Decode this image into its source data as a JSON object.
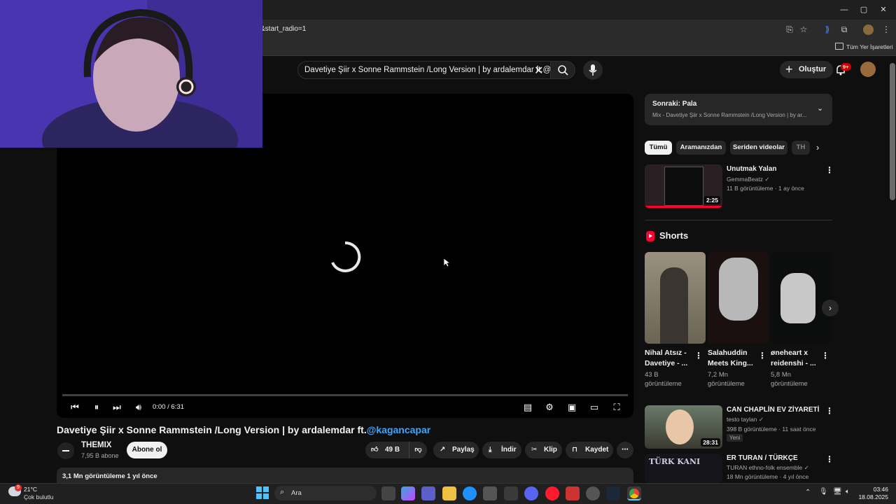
{
  "browser": {
    "address": "&start_radio=1",
    "bookmarks_label": "Tüm Yer İşaretleri",
    "window_minimize": "—",
    "window_restore": "▢",
    "window_close": "✕",
    "notifications_badge": "9+"
  },
  "header": {
    "search_value": "Davetiye Şiir x Sonne Rammstein /Long Version | by ardalemdar ft.@k",
    "create_label": "Oluştur",
    "notif_badge": "9+"
  },
  "player": {
    "time": "0:00 / 6:31",
    "progress": 0.0
  },
  "video": {
    "title_prefix": "Davetiye Şiir x Sonne Rammstein /Long Version | by ardalemdar ft.",
    "title_tag": "@kagancapar",
    "channel_name": "THEMIX",
    "channel_subs": "7,95 B abone",
    "subscribe_label": "Abone ol",
    "likes": "49 B",
    "share_label": "Paylaş",
    "download_label": "İndir",
    "clip_label": "Klip",
    "save_label": "Kaydet",
    "views_age": "3,1 Mn görüntüleme  1 yıl önce"
  },
  "sidebar": {
    "next_title": "Sonraki: Pala",
    "next_subtitle": "Mix - Davetiye Şiir x Sonne Rammstein /Long Version | by ar...",
    "chips": [
      "Tümü",
      "Aramanızdan",
      "Seriden videolar",
      "TH"
    ],
    "first_video": {
      "title": "Unutmak Yalan",
      "channel": "GemmaBeatz",
      "meta": "11 B görüntüleme · 1 ay önce",
      "duration": "2:25"
    },
    "shorts_label": "Shorts",
    "shorts": [
      {
        "title1": "Nihal Atsız -",
        "title2": "Davetiye - ...",
        "views": "43 B",
        "views_label": "görüntüleme"
      },
      {
        "title1": "Salahuddin",
        "title2": "Meets King...",
        "views": "7,2 Mn",
        "views_label": "görüntüleme"
      },
      {
        "title1": "øneheart x",
        "title2": "reidenshi - ...",
        "views": "5,8 Mn",
        "views_label": "görüntüleme"
      }
    ],
    "videos": [
      {
        "title": "CAN CHAPLİN EV ZİYARETİ",
        "channel": "testo taylan",
        "meta": "398 B görüntüleme · 11 saat önce",
        "badge": "Yeni",
        "duration": "28:31"
      },
      {
        "title": "ER TURAN / TÜRKÇE",
        "channel": "TURAN ethno-folk ensemble",
        "meta": "18 Mn görüntüleme · 4 yıl önce",
        "thumb_text": "TÜRK KANI"
      }
    ]
  },
  "taskbar": {
    "weather_temp": "21°C",
    "weather_desc": "Çok bulutlu",
    "weather_badge": "9",
    "search_label": "Ara",
    "time": "03:46",
    "date": "18.08.2025"
  },
  "colors": {
    "accent_red": "#ff0033",
    "link_blue": "#3ea6ff",
    "bg": "#0f0f0f"
  }
}
